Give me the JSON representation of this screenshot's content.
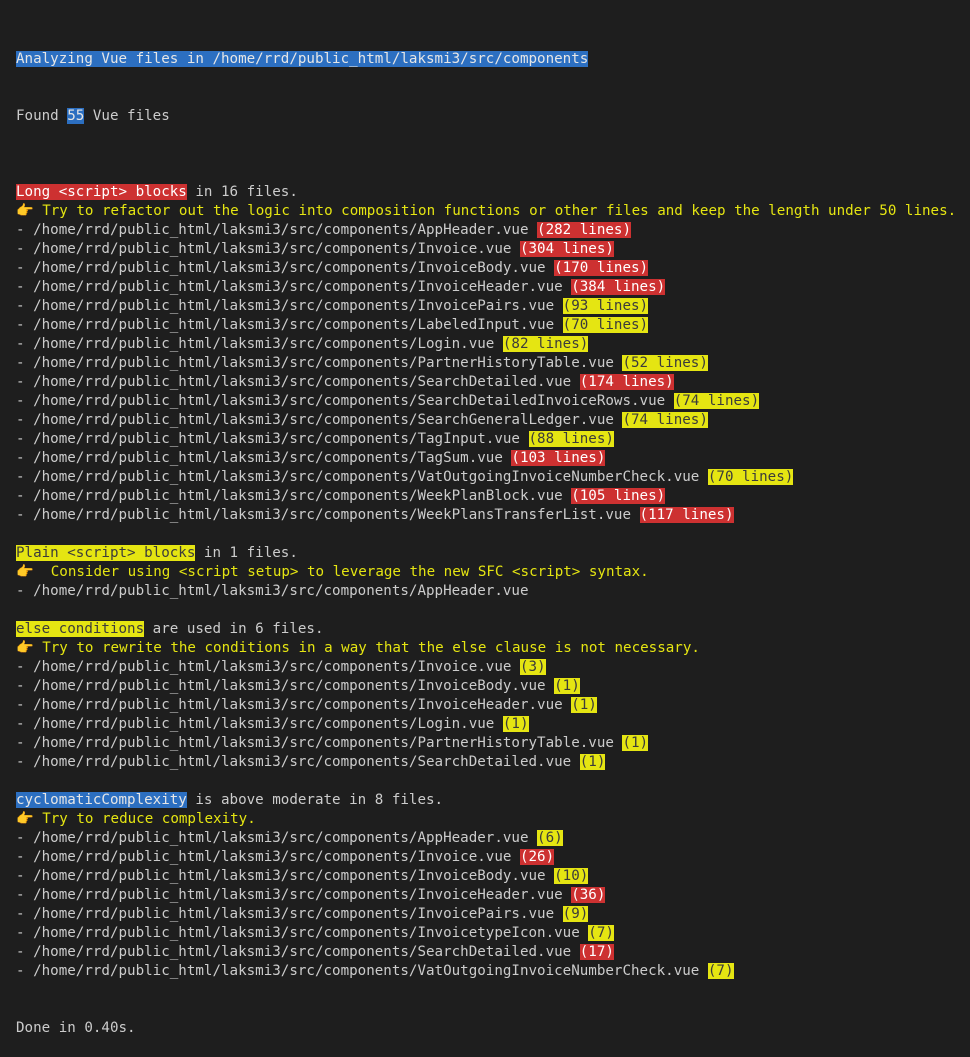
{
  "colors": {
    "background": "#1e1e1e",
    "text": "#cccccc",
    "highlight_blue": "#2c6fc1",
    "highlight_red": "#cd3131",
    "highlight_yellow": "#e5e512",
    "tip_yellow": "#e5e512"
  },
  "header": {
    "analyzing": "Analyzing Vue files in /home/rrd/public_html/laksmi3/src/components",
    "found_prefix": "Found ",
    "found_count": "55",
    "found_suffix": " Vue files"
  },
  "sections": [
    {
      "key": "long-script",
      "title": "Long <script> blocks",
      "title_style": "red",
      "title_rest": " in 16 files.",
      "tip_icon": "pointing-hand-icon",
      "tip": "👉 Try to refactor out the logic into composition functions or other files and keep the length under 50 lines.",
      "items": [
        {
          "path": "- /home/rrd/public_html/laksmi3/src/components/AppHeader.vue",
          "badge": "(282 lines)",
          "level": "red"
        },
        {
          "path": "- /home/rrd/public_html/laksmi3/src/components/Invoice.vue",
          "badge": "(304 lines)",
          "level": "red"
        },
        {
          "path": "- /home/rrd/public_html/laksmi3/src/components/InvoiceBody.vue",
          "badge": "(170 lines)",
          "level": "red"
        },
        {
          "path": "- /home/rrd/public_html/laksmi3/src/components/InvoiceHeader.vue",
          "badge": "(384 lines)",
          "level": "red"
        },
        {
          "path": "- /home/rrd/public_html/laksmi3/src/components/InvoicePairs.vue",
          "badge": "(93 lines)",
          "level": "yellow"
        },
        {
          "path": "- /home/rrd/public_html/laksmi3/src/components/LabeledInput.vue",
          "badge": "(70 lines)",
          "level": "yellow"
        },
        {
          "path": "- /home/rrd/public_html/laksmi3/src/components/Login.vue",
          "badge": "(82 lines)",
          "level": "yellow"
        },
        {
          "path": "- /home/rrd/public_html/laksmi3/src/components/PartnerHistoryTable.vue",
          "badge": "(52 lines)",
          "level": "yellow"
        },
        {
          "path": "- /home/rrd/public_html/laksmi3/src/components/SearchDetailed.vue",
          "badge": "(174 lines)",
          "level": "red"
        },
        {
          "path": "- /home/rrd/public_html/laksmi3/src/components/SearchDetailedInvoiceRows.vue",
          "badge": "(74 lines)",
          "level": "yellow"
        },
        {
          "path": "- /home/rrd/public_html/laksmi3/src/components/SearchGeneralLedger.vue",
          "badge": "(74 lines)",
          "level": "yellow"
        },
        {
          "path": "- /home/rrd/public_html/laksmi3/src/components/TagInput.vue",
          "badge": "(88 lines)",
          "level": "yellow"
        },
        {
          "path": "- /home/rrd/public_html/laksmi3/src/components/TagSum.vue",
          "badge": "(103 lines)",
          "level": "red"
        },
        {
          "path": "- /home/rrd/public_html/laksmi3/src/components/VatOutgoingInvoiceNumberCheck.vue",
          "badge": "(70 lines)",
          "level": "yellow"
        },
        {
          "path": "- /home/rrd/public_html/laksmi3/src/components/WeekPlanBlock.vue",
          "badge": "(105 lines)",
          "level": "red"
        },
        {
          "path": "- /home/rrd/public_html/laksmi3/src/components/WeekPlansTransferList.vue",
          "badge": "(117 lines)",
          "level": "red"
        }
      ]
    },
    {
      "key": "plain-script",
      "title": "Plain <script> blocks",
      "title_style": "yellow",
      "title_rest": " in 1 files.",
      "tip_icon": "pointing-hand-icon",
      "tip": "👉  Consider using <script setup> to leverage the new SFC <script> syntax.",
      "items": [
        {
          "path": "- /home/rrd/public_html/laksmi3/src/components/AppHeader.vue",
          "badge": "",
          "level": "none"
        }
      ]
    },
    {
      "key": "else-conditions",
      "title": "else conditions",
      "title_style": "yellow",
      "title_rest": " are used in 6 files.",
      "tip_icon": "pointing-hand-icon",
      "tip": "👉 Try to rewrite the conditions in a way that the else clause is not necessary.",
      "items": [
        {
          "path": "- /home/rrd/public_html/laksmi3/src/components/Invoice.vue",
          "badge": "(3)",
          "level": "yellow"
        },
        {
          "path": "- /home/rrd/public_html/laksmi3/src/components/InvoiceBody.vue",
          "badge": "(1)",
          "level": "yellow"
        },
        {
          "path": "- /home/rrd/public_html/laksmi3/src/components/InvoiceHeader.vue",
          "badge": "(1)",
          "level": "yellow"
        },
        {
          "path": "- /home/rrd/public_html/laksmi3/src/components/Login.vue",
          "badge": "(1)",
          "level": "yellow"
        },
        {
          "path": "- /home/rrd/public_html/laksmi3/src/components/PartnerHistoryTable.vue",
          "badge": "(1)",
          "level": "yellow"
        },
        {
          "path": "- /home/rrd/public_html/laksmi3/src/components/SearchDetailed.vue",
          "badge": "(1)",
          "level": "yellow"
        }
      ]
    },
    {
      "key": "cyclomatic-complexity",
      "title": "cyclomaticComplexity",
      "title_style": "blue",
      "title_rest": " is above moderate in 8 files.",
      "tip_icon": "pointing-hand-icon",
      "tip": "👉 Try to reduce complexity.",
      "items": [
        {
          "path": "- /home/rrd/public_html/laksmi3/src/components/AppHeader.vue",
          "badge": "(6)",
          "level": "yellow"
        },
        {
          "path": "- /home/rrd/public_html/laksmi3/src/components/Invoice.vue",
          "badge": "(26)",
          "level": "red"
        },
        {
          "path": "- /home/rrd/public_html/laksmi3/src/components/InvoiceBody.vue",
          "badge": "(10)",
          "level": "yellow"
        },
        {
          "path": "- /home/rrd/public_html/laksmi3/src/components/InvoiceHeader.vue",
          "badge": "(36)",
          "level": "red"
        },
        {
          "path": "- /home/rrd/public_html/laksmi3/src/components/InvoicePairs.vue",
          "badge": "(9)",
          "level": "yellow"
        },
        {
          "path": "- /home/rrd/public_html/laksmi3/src/components/InvoicetypeIcon.vue",
          "badge": "(7)",
          "level": "yellow"
        },
        {
          "path": "- /home/rrd/public_html/laksmi3/src/components/SearchDetailed.vue",
          "badge": "(17)",
          "level": "red"
        },
        {
          "path": "- /home/rrd/public_html/laksmi3/src/components/VatOutgoingInvoiceNumberCheck.vue",
          "badge": "(7)",
          "level": "yellow"
        }
      ]
    }
  ],
  "footer": {
    "done": "Done in 0.40s."
  }
}
